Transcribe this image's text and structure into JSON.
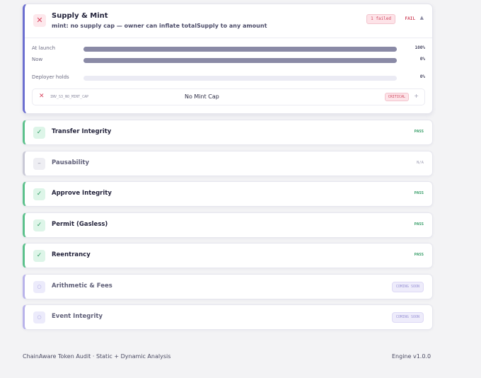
{
  "supply": {
    "title": "Supply & Mint",
    "subtitle": "mint: no supply cap — owner can inflate totalSupply to any amount",
    "failed_badge": "1 failed",
    "status": "FAIL",
    "bars": [
      {
        "label": "At launch",
        "value_text": "100%",
        "fraction": 1.0
      },
      {
        "label": "Now",
        "value_text": "0%",
        "fraction": 1.0
      },
      {
        "label": "Deployer holds",
        "value_text": "0%",
        "fraction": 0
      }
    ],
    "finding": {
      "code": "INV_S3_NO_MINT_CAP",
      "name": "No Mint Cap",
      "severity": "CRITICAL"
    }
  },
  "checks": [
    {
      "label": "Transfer Integrity",
      "status": "PASS",
      "kind": "pass",
      "icon": "check-icon"
    },
    {
      "label": "Pausability",
      "status": "N/A",
      "kind": "na",
      "icon": "dash-icon"
    },
    {
      "label": "Approve Integrity",
      "status": "PASS",
      "kind": "pass",
      "icon": "check-icon"
    },
    {
      "label": "Permit (Gasless)",
      "status": "PASS",
      "kind": "pass",
      "icon": "check-icon"
    },
    {
      "label": "Reentrancy",
      "status": "PASS",
      "kind": "pass",
      "icon": "check-icon"
    },
    {
      "label": "Arithmetic & Fees",
      "status": "COMING SOON",
      "kind": "soon",
      "icon": "circle-icon"
    },
    {
      "label": "Event Integrity",
      "status": "COMING SOON",
      "kind": "soon",
      "icon": "circle-icon"
    }
  ],
  "footer": {
    "left": "ChainAware Token Audit · Static + Dynamic Analysis",
    "right": "Engine v1.0.0"
  },
  "colors": {
    "accent": "#6c6fd0",
    "pass": "#2f9a62",
    "fail": "#d14b62",
    "soon": "#9b95d6"
  }
}
